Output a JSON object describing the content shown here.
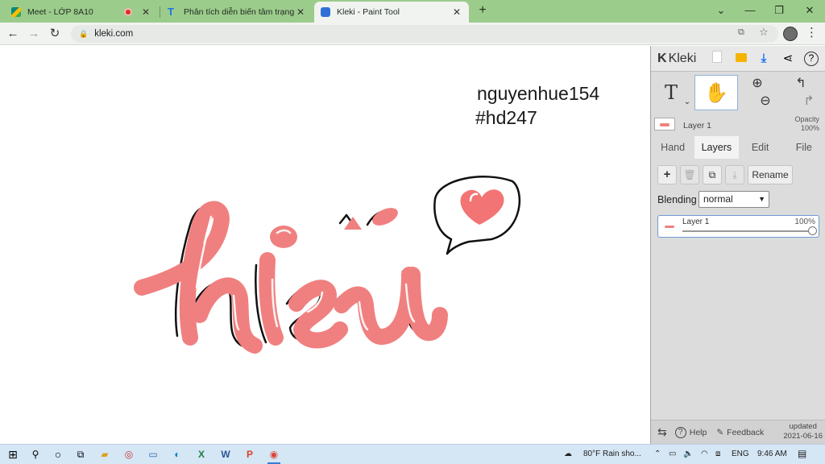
{
  "browser": {
    "tabs": [
      {
        "title": "Meet - LỚP 8A10",
        "active": false
      },
      {
        "title": "Phân tích diễn biến tâm trạng củ",
        "active": false
      },
      {
        "title": "Kleki - Paint Tool",
        "active": true
      }
    ],
    "new_tab": "+",
    "window_controls": {
      "minimize": "⌄",
      "restore": "—",
      "maximize": "❐",
      "close": "✕"
    },
    "url": "kleki.com"
  },
  "canvas": {
    "signature_line1": "nguyenhue154",
    "signature_line2": "#hd247",
    "artwork_word": "hiếu",
    "colors": {
      "ink": "#f08080",
      "outline": "#111111",
      "heart": "#f27474"
    }
  },
  "panel": {
    "logo": "Kleki",
    "layer_name": "Layer 1",
    "opacity_label": "Opacity",
    "opacity_value": "100%",
    "tabs": [
      "Hand",
      "Layers",
      "Edit",
      "File"
    ],
    "active_tab": "Layers",
    "buttons": {
      "rename": "Rename"
    },
    "blending_label": "Blending",
    "blending_value": "normal",
    "layers": [
      {
        "name": "Layer 1",
        "opacity": "100%"
      }
    ],
    "footer": {
      "help": "Help",
      "feedback": "Feedback",
      "updated_label": "updated",
      "updated_date": "2021-06-16"
    }
  },
  "taskbar": {
    "weather": "80°F  Rain sho...",
    "lang": "ENG",
    "time": "9:46 AM"
  }
}
